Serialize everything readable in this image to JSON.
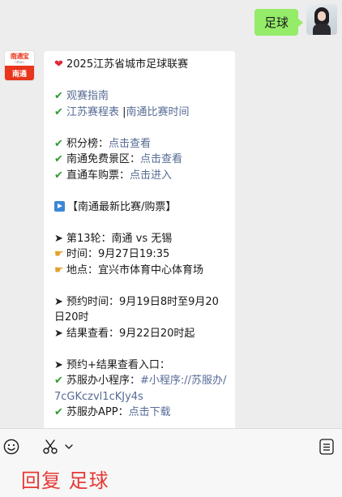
{
  "user_message": {
    "text": "足球"
  },
  "official_account": {
    "logo_text": "南通宝",
    "logo_site": "ntbao",
    "name_badge": "南通"
  },
  "message": {
    "title": "2025江苏省城市足球联赛",
    "links": {
      "viewing_guide": "观赛指南",
      "jiangsu_schedule": "江苏赛程表",
      "separator": "|",
      "nantong_match_time": "南通比赛时间"
    },
    "standings_label": "积分榜：",
    "free_scenic_label": "南通免费景区：",
    "direct_bus_label": "直通车购票：",
    "click_view": "点击查看",
    "click_enter": "点击进入",
    "latest_section": "【南通最新比赛/购票】",
    "round_line": "第13轮：南通 vs 无锡",
    "time_line": "时间：9月27日19:35",
    "location_line": "地点：宜兴市体育中心体育场",
    "booking_time_line": "预约时间：9月19日8时至9月20日20时",
    "result_check_line": "结果查看：9月22日20时起",
    "entry_line": "预约+结果查看入口：",
    "suban_miniprogram_label": "苏服办小程序：",
    "suban_miniprogram_link": "#小程序://苏服办/7cGKczvl1cKJy4s",
    "suban_app_label": "苏服办APP：",
    "click_download": "点击下载"
  },
  "icons": {
    "heart": "heart-icon",
    "check": "check-icon",
    "play": "play-icon",
    "arrow": "arrow-icon",
    "pointing": "pointing-hand-icon",
    "emoji": "emoji-icon",
    "scissors": "scissors-icon",
    "menu": "menu-icon"
  },
  "colors": {
    "user_bubble": "#95ec69",
    "link": "#576b95",
    "check": "#2e9a32",
    "caption": "#e53935"
  },
  "caption": {
    "text": "回复 足球"
  }
}
